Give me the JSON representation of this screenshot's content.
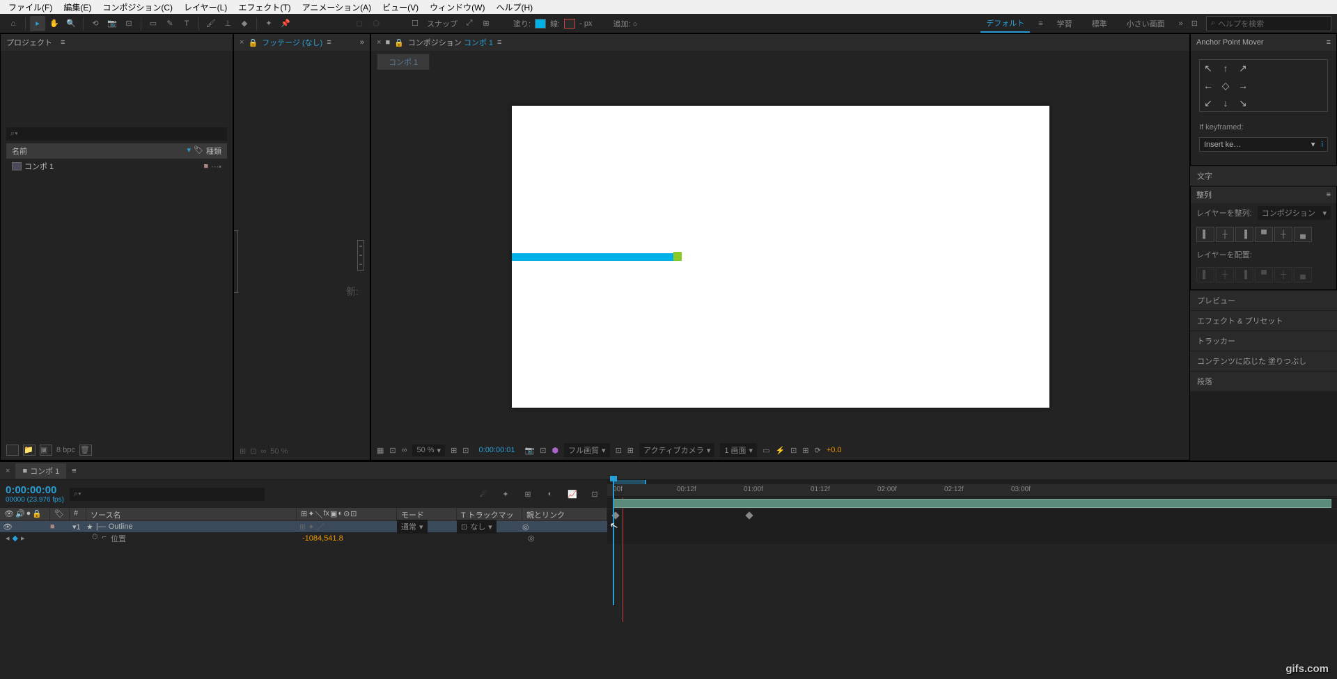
{
  "menu": {
    "file": "ファイル(F)",
    "edit": "編集(E)",
    "comp": "コンポジション(C)",
    "layer": "レイヤー(L)",
    "effect": "エフェクト(T)",
    "anim": "アニメーション(A)",
    "view": "ビュー(V)",
    "window": "ウィンドウ(W)",
    "help": "ヘルプ(H)"
  },
  "toolbar": {
    "snap": "スナップ",
    "fill": "塗り:",
    "stroke": "線:",
    "stroke_px": "- px",
    "add": "追加: ○",
    "ws_default": "デフォルト",
    "ws_learn": "学習",
    "ws_standard": "標準",
    "ws_small": "小さい画面",
    "search_placeholder": "ヘルプを検索"
  },
  "project": {
    "title": "プロジェクト",
    "col_name": "名前",
    "col_type": "種類",
    "item1": "コンポ 1",
    "bpc": "8 bpc"
  },
  "footage": {
    "title_prefix": "フッテージ",
    "title_none": "(なし)",
    "new_label": "新:",
    "pct": "50 %"
  },
  "comp": {
    "title_prefix": "コンポジション",
    "title_name": "コンポ 1",
    "tab": "コンポ 1",
    "zoom": "50 %",
    "time": "0:00:00:01",
    "quality": "フル画質",
    "camera": "アクティブカメラ",
    "views": "1 画面",
    "exposure": "+0.0"
  },
  "right": {
    "anchor_title": "Anchor Point Mover",
    "if_kf": "If keyframed:",
    "insert": "Insert ke…",
    "char": "文字",
    "align": "整列",
    "align_to_label": "レイヤーを整列:",
    "align_to_value": "コンポジション",
    "distribute_label": "レイヤーを配置:",
    "preview": "プレビュー",
    "effects": "エフェクト & プリセット",
    "tracker": "トラッカー",
    "content_fill": "コンテンツに応じた 塗りつぶし",
    "para": "段落"
  },
  "timeline": {
    "tab": "コンポ 1",
    "timecode": "0:00:00:00",
    "timecode_sub": "00000 (23.976 fps)",
    "col_num": "#",
    "col_source": "ソース名",
    "col_mode": "モード",
    "col_mode_val": "通常",
    "col_track": "T トラックマット",
    "col_track_val": "なし",
    "col_parent": "親とリンク",
    "layer_num": "1",
    "layer_name": "Outline",
    "prop_name": "位置",
    "prop_val": "-1084,541.8",
    "ticks": [
      "00f",
      "00:12f",
      "01:00f",
      "01:12f",
      "02:00f",
      "02:12f",
      "03:00f"
    ]
  },
  "watermark": "gifs.com"
}
